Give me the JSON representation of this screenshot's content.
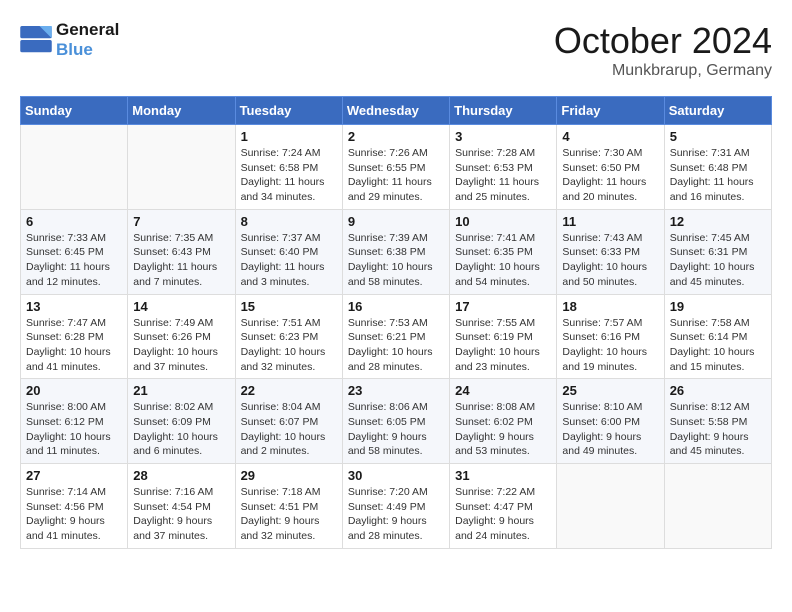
{
  "header": {
    "logo_line1": "General",
    "logo_line2": "Blue",
    "month_title": "October 2024",
    "location": "Munkbrarup, Germany"
  },
  "weekdays": [
    "Sunday",
    "Monday",
    "Tuesday",
    "Wednesday",
    "Thursday",
    "Friday",
    "Saturday"
  ],
  "weeks": [
    [
      {
        "day": "",
        "sunrise": "",
        "sunset": "",
        "daylight": ""
      },
      {
        "day": "",
        "sunrise": "",
        "sunset": "",
        "daylight": ""
      },
      {
        "day": "1",
        "sunrise": "Sunrise: 7:24 AM",
        "sunset": "Sunset: 6:58 PM",
        "daylight": "Daylight: 11 hours and 34 minutes."
      },
      {
        "day": "2",
        "sunrise": "Sunrise: 7:26 AM",
        "sunset": "Sunset: 6:55 PM",
        "daylight": "Daylight: 11 hours and 29 minutes."
      },
      {
        "day": "3",
        "sunrise": "Sunrise: 7:28 AM",
        "sunset": "Sunset: 6:53 PM",
        "daylight": "Daylight: 11 hours and 25 minutes."
      },
      {
        "day": "4",
        "sunrise": "Sunrise: 7:30 AM",
        "sunset": "Sunset: 6:50 PM",
        "daylight": "Daylight: 11 hours and 20 minutes."
      },
      {
        "day": "5",
        "sunrise": "Sunrise: 7:31 AM",
        "sunset": "Sunset: 6:48 PM",
        "daylight": "Daylight: 11 hours and 16 minutes."
      }
    ],
    [
      {
        "day": "6",
        "sunrise": "Sunrise: 7:33 AM",
        "sunset": "Sunset: 6:45 PM",
        "daylight": "Daylight: 11 hours and 12 minutes."
      },
      {
        "day": "7",
        "sunrise": "Sunrise: 7:35 AM",
        "sunset": "Sunset: 6:43 PM",
        "daylight": "Daylight: 11 hours and 7 minutes."
      },
      {
        "day": "8",
        "sunrise": "Sunrise: 7:37 AM",
        "sunset": "Sunset: 6:40 PM",
        "daylight": "Daylight: 11 hours and 3 minutes."
      },
      {
        "day": "9",
        "sunrise": "Sunrise: 7:39 AM",
        "sunset": "Sunset: 6:38 PM",
        "daylight": "Daylight: 10 hours and 58 minutes."
      },
      {
        "day": "10",
        "sunrise": "Sunrise: 7:41 AM",
        "sunset": "Sunset: 6:35 PM",
        "daylight": "Daylight: 10 hours and 54 minutes."
      },
      {
        "day": "11",
        "sunrise": "Sunrise: 7:43 AM",
        "sunset": "Sunset: 6:33 PM",
        "daylight": "Daylight: 10 hours and 50 minutes."
      },
      {
        "day": "12",
        "sunrise": "Sunrise: 7:45 AM",
        "sunset": "Sunset: 6:31 PM",
        "daylight": "Daylight: 10 hours and 45 minutes."
      }
    ],
    [
      {
        "day": "13",
        "sunrise": "Sunrise: 7:47 AM",
        "sunset": "Sunset: 6:28 PM",
        "daylight": "Daylight: 10 hours and 41 minutes."
      },
      {
        "day": "14",
        "sunrise": "Sunrise: 7:49 AM",
        "sunset": "Sunset: 6:26 PM",
        "daylight": "Daylight: 10 hours and 37 minutes."
      },
      {
        "day": "15",
        "sunrise": "Sunrise: 7:51 AM",
        "sunset": "Sunset: 6:23 PM",
        "daylight": "Daylight: 10 hours and 32 minutes."
      },
      {
        "day": "16",
        "sunrise": "Sunrise: 7:53 AM",
        "sunset": "Sunset: 6:21 PM",
        "daylight": "Daylight: 10 hours and 28 minutes."
      },
      {
        "day": "17",
        "sunrise": "Sunrise: 7:55 AM",
        "sunset": "Sunset: 6:19 PM",
        "daylight": "Daylight: 10 hours and 23 minutes."
      },
      {
        "day": "18",
        "sunrise": "Sunrise: 7:57 AM",
        "sunset": "Sunset: 6:16 PM",
        "daylight": "Daylight: 10 hours and 19 minutes."
      },
      {
        "day": "19",
        "sunrise": "Sunrise: 7:58 AM",
        "sunset": "Sunset: 6:14 PM",
        "daylight": "Daylight: 10 hours and 15 minutes."
      }
    ],
    [
      {
        "day": "20",
        "sunrise": "Sunrise: 8:00 AM",
        "sunset": "Sunset: 6:12 PM",
        "daylight": "Daylight: 10 hours and 11 minutes."
      },
      {
        "day": "21",
        "sunrise": "Sunrise: 8:02 AM",
        "sunset": "Sunset: 6:09 PM",
        "daylight": "Daylight: 10 hours and 6 minutes."
      },
      {
        "day": "22",
        "sunrise": "Sunrise: 8:04 AM",
        "sunset": "Sunset: 6:07 PM",
        "daylight": "Daylight: 10 hours and 2 minutes."
      },
      {
        "day": "23",
        "sunrise": "Sunrise: 8:06 AM",
        "sunset": "Sunset: 6:05 PM",
        "daylight": "Daylight: 9 hours and 58 minutes."
      },
      {
        "day": "24",
        "sunrise": "Sunrise: 8:08 AM",
        "sunset": "Sunset: 6:02 PM",
        "daylight": "Daylight: 9 hours and 53 minutes."
      },
      {
        "day": "25",
        "sunrise": "Sunrise: 8:10 AM",
        "sunset": "Sunset: 6:00 PM",
        "daylight": "Daylight: 9 hours and 49 minutes."
      },
      {
        "day": "26",
        "sunrise": "Sunrise: 8:12 AM",
        "sunset": "Sunset: 5:58 PM",
        "daylight": "Daylight: 9 hours and 45 minutes."
      }
    ],
    [
      {
        "day": "27",
        "sunrise": "Sunrise: 7:14 AM",
        "sunset": "Sunset: 4:56 PM",
        "daylight": "Daylight: 9 hours and 41 minutes."
      },
      {
        "day": "28",
        "sunrise": "Sunrise: 7:16 AM",
        "sunset": "Sunset: 4:54 PM",
        "daylight": "Daylight: 9 hours and 37 minutes."
      },
      {
        "day": "29",
        "sunrise": "Sunrise: 7:18 AM",
        "sunset": "Sunset: 4:51 PM",
        "daylight": "Daylight: 9 hours and 32 minutes."
      },
      {
        "day": "30",
        "sunrise": "Sunrise: 7:20 AM",
        "sunset": "Sunset: 4:49 PM",
        "daylight": "Daylight: 9 hours and 28 minutes."
      },
      {
        "day": "31",
        "sunrise": "Sunrise: 7:22 AM",
        "sunset": "Sunset: 4:47 PM",
        "daylight": "Daylight: 9 hours and 24 minutes."
      },
      {
        "day": "",
        "sunrise": "",
        "sunset": "",
        "daylight": ""
      },
      {
        "day": "",
        "sunrise": "",
        "sunset": "",
        "daylight": ""
      }
    ]
  ]
}
